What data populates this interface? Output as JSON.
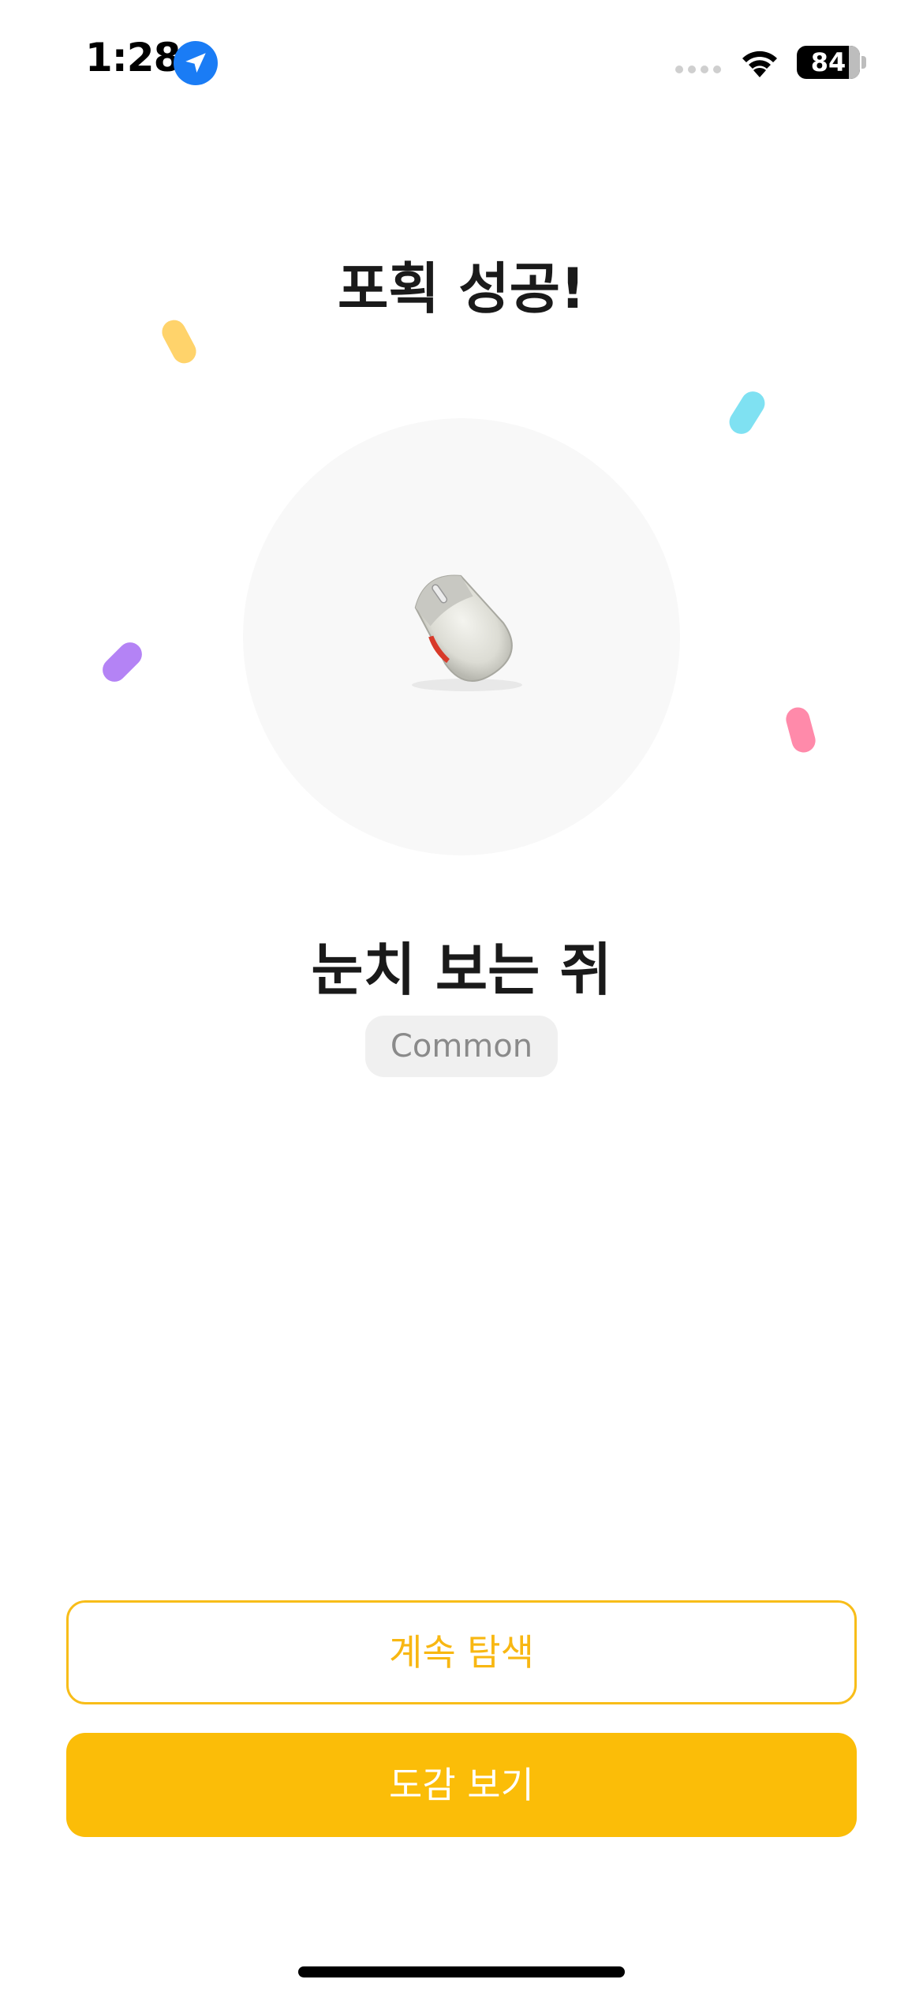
{
  "status_bar": {
    "time": "1:28",
    "battery": "84",
    "icons": [
      "location-arrow-icon",
      "cellular-signal-icon",
      "wifi-icon",
      "battery-icon"
    ]
  },
  "title": "포획 성공!",
  "creature": {
    "name": "눈치 보는 쥐",
    "rarity": "Common",
    "image": "computer-mouse"
  },
  "buttons": {
    "continue_label": "계속 탐색",
    "collection_label": "도감 보기"
  },
  "colors": {
    "accent": "#fbbd08",
    "confetti": [
      "#ffd36b",
      "#7fe1f2",
      "#b483f5",
      "#ff8aaa"
    ]
  }
}
